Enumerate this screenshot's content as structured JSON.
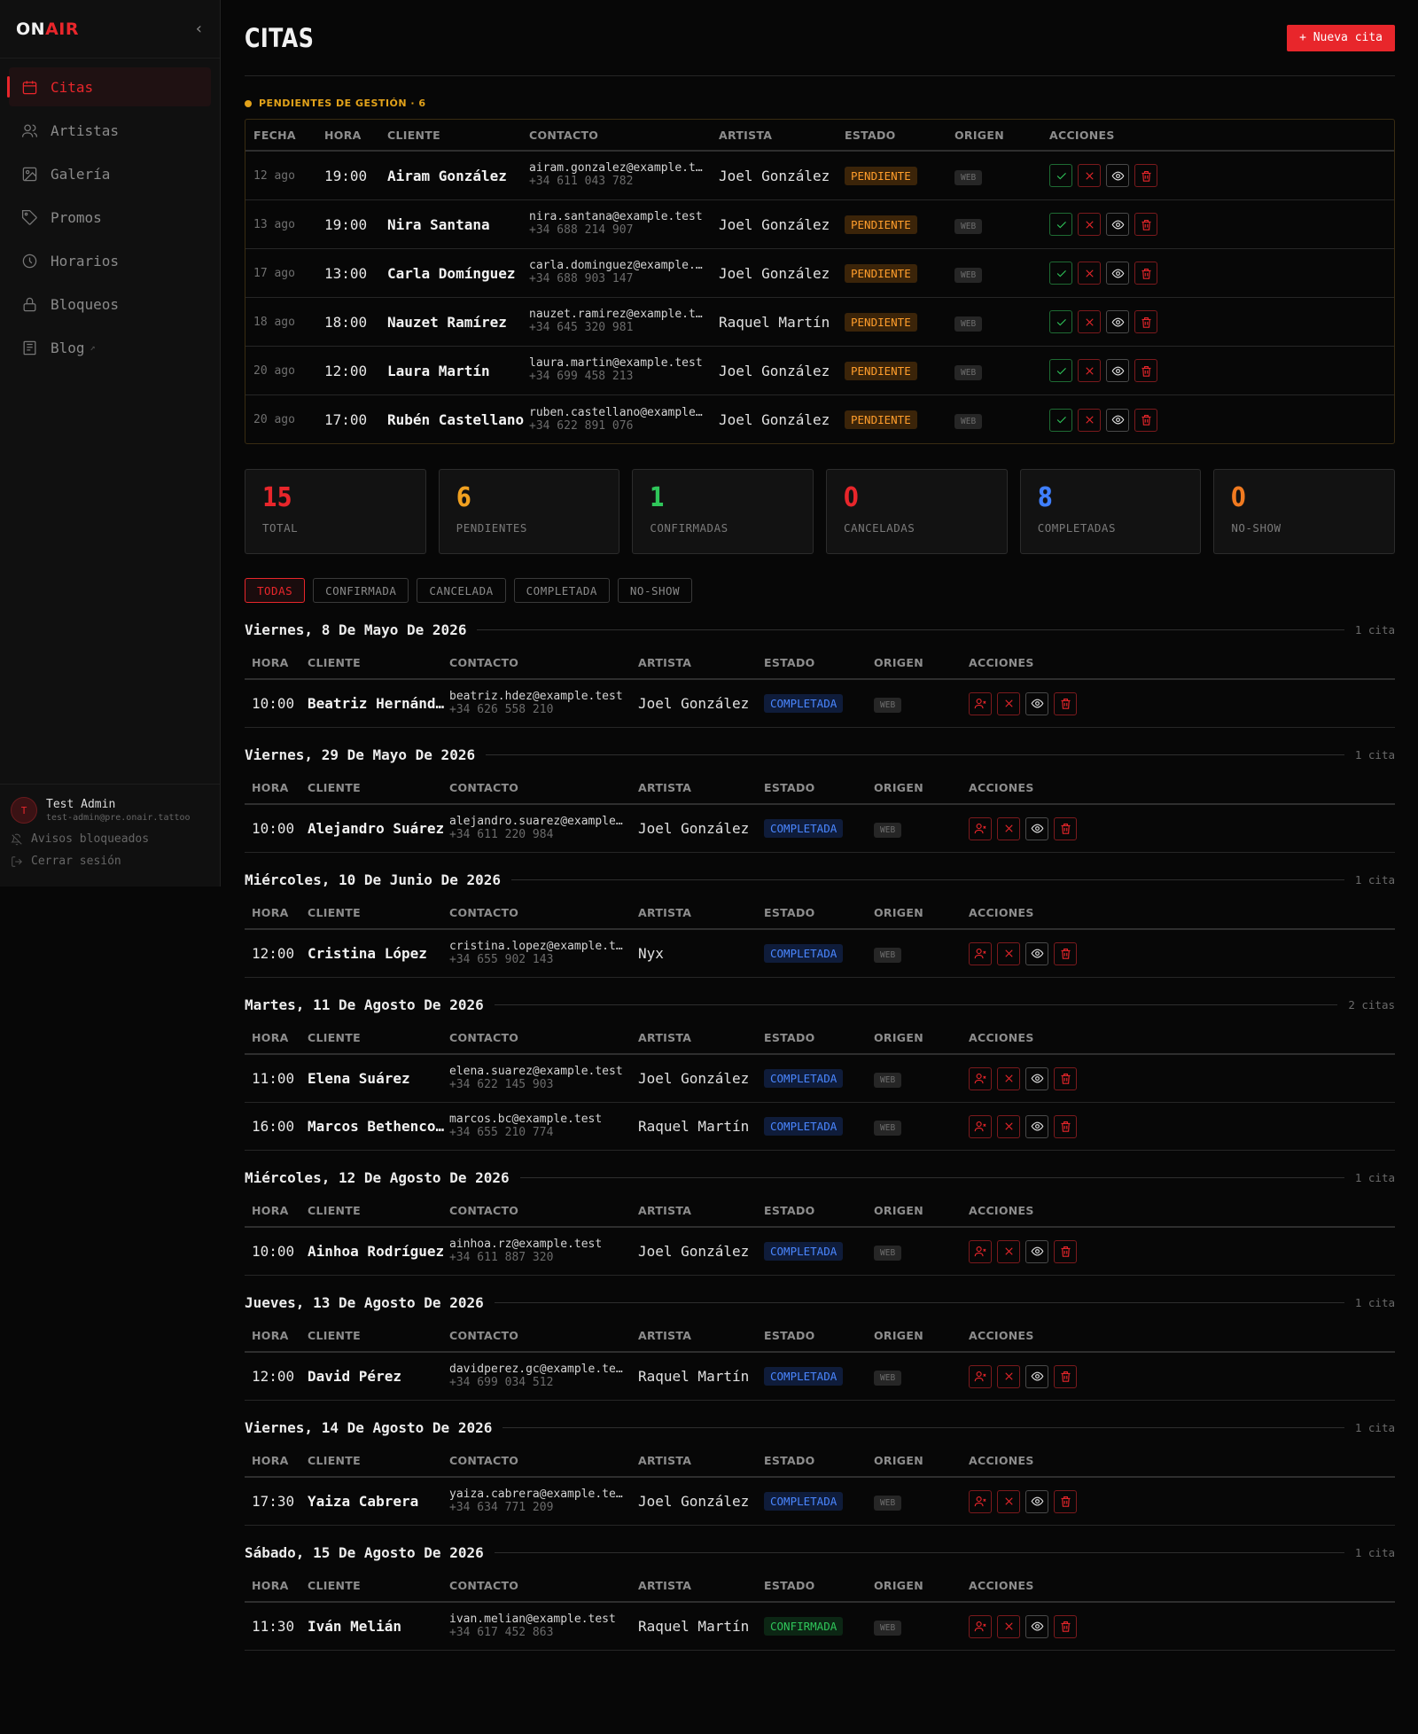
{
  "app": {
    "logo_on": "ON",
    "logo_air": "AIR"
  },
  "sidebar": {
    "items": [
      {
        "label": "Citas",
        "icon": "calendar-icon"
      },
      {
        "label": "Artistas",
        "icon": "users-icon"
      },
      {
        "label": "Galería",
        "icon": "image-icon"
      },
      {
        "label": "Promos",
        "icon": "tag-icon"
      },
      {
        "label": "Horarios",
        "icon": "clock-icon"
      },
      {
        "label": "Bloqueos",
        "icon": "lock-icon"
      },
      {
        "label": "Blog",
        "icon": "blog-icon",
        "ext": "↗"
      }
    ],
    "user": {
      "initial": "T",
      "name": "Test Admin",
      "email": "test-admin@pre.onair.tattoo"
    },
    "notices": "Avisos bloqueados",
    "logout": "Cerrar sesión"
  },
  "header": {
    "title": "CITAS",
    "new_button": "+ Nueva cita"
  },
  "pending": {
    "title": "PENDIENTES DE GESTIÓN · 6",
    "columns": [
      "FECHA",
      "HORA",
      "CLIENTE",
      "CONTACTO",
      "ARTISTA",
      "ESTADO",
      "ORIGEN",
      "ACCIONES"
    ],
    "rows": [
      {
        "date": "12 ago",
        "time": "19:00",
        "client": "Airam González",
        "email": "airam.gonzalez@example.test",
        "phone": "+34 611 043 782",
        "artist": "Joel González",
        "status": "PENDIENTE",
        "origin": "WEB"
      },
      {
        "date": "13 ago",
        "time": "19:00",
        "client": "Nira Santana",
        "email": "nira.santana@example.test",
        "phone": "+34 688 214 907",
        "artist": "Joel González",
        "status": "PENDIENTE",
        "origin": "WEB"
      },
      {
        "date": "17 ago",
        "time": "13:00",
        "client": "Carla Domínguez",
        "email": "carla.dominguez@example.test",
        "phone": "+34 688 903 147",
        "artist": "Joel González",
        "status": "PENDIENTE",
        "origin": "WEB"
      },
      {
        "date": "18 ago",
        "time": "18:00",
        "client": "Nauzet Ramírez",
        "email": "nauzet.ramirez@example.test",
        "phone": "+34 645 320 981",
        "artist": "Raquel Martín",
        "status": "PENDIENTE",
        "origin": "WEB"
      },
      {
        "date": "20 ago",
        "time": "12:00",
        "client": "Laura Martín",
        "email": "laura.martin@example.test",
        "phone": "+34 699 458 213",
        "artist": "Joel González",
        "status": "PENDIENTE",
        "origin": "WEB"
      },
      {
        "date": "20 ago",
        "time": "17:00",
        "client": "Rubén Castellano",
        "email": "ruben.castellano@example.test",
        "phone": "+34 622 891 076",
        "artist": "Joel González",
        "status": "PENDIENTE",
        "origin": "WEB"
      }
    ]
  },
  "stats": [
    {
      "value": "15",
      "label": "TOTAL",
      "color": "#e8262b"
    },
    {
      "value": "6",
      "label": "PENDIENTES",
      "color": "#f0a020"
    },
    {
      "value": "1",
      "label": "CONFIRMADAS",
      "color": "#2fc65a"
    },
    {
      "value": "0",
      "label": "CANCELADAS",
      "color": "#e8262b"
    },
    {
      "value": "8",
      "label": "COMPLETADAS",
      "color": "#3f7fff"
    },
    {
      "value": "0",
      "label": "NO-SHOW",
      "color": "#f07a20"
    }
  ],
  "filters": [
    "TODAS",
    "CONFIRMADA",
    "CANCELADA",
    "COMPLETADA",
    "NO-SHOW"
  ],
  "group_columns": [
    "HORA",
    "CLIENTE",
    "CONTACTO",
    "ARTISTA",
    "ESTADO",
    "ORIGEN",
    "ACCIONES"
  ],
  "groups": [
    {
      "title": "Viernes, 8 De Mayo De 2026",
      "count": "1 cita",
      "rows": [
        {
          "time": "10:00",
          "client": "Beatriz Hernández",
          "email": "beatriz.hdez@example.test",
          "phone": "+34 626 558 210",
          "artist": "Joel González",
          "status": "COMPLETADA",
          "origin": "WEB"
        }
      ]
    },
    {
      "title": "Viernes, 29 De Mayo De 2026",
      "count": "1 cita",
      "rows": [
        {
          "time": "10:00",
          "client": "Alejandro Suárez",
          "email": "alejandro.suarez@example.test",
          "phone": "+34 611 220 984",
          "artist": "Joel González",
          "status": "COMPLETADA",
          "origin": "WEB"
        }
      ]
    },
    {
      "title": "Miércoles, 10 De Junio De 2026",
      "count": "1 cita",
      "rows": [
        {
          "time": "12:00",
          "client": "Cristina López",
          "email": "cristina.lopez@example.test",
          "phone": "+34 655 902 143",
          "artist": "Nyx",
          "status": "COMPLETADA",
          "origin": "WEB"
        }
      ]
    },
    {
      "title": "Martes, 11 De Agosto De 2026",
      "count": "2 citas",
      "rows": [
        {
          "time": "11:00",
          "client": "Elena Suárez",
          "email": "elena.suarez@example.test",
          "phone": "+34 622 145 903",
          "artist": "Joel González",
          "status": "COMPLETADA",
          "origin": "WEB"
        },
        {
          "time": "16:00",
          "client": "Marcos Bethencourt",
          "email": "marcos.bc@example.test",
          "phone": "+34 655 210 774",
          "artist": "Raquel Martín",
          "status": "COMPLETADA",
          "origin": "WEB"
        }
      ]
    },
    {
      "title": "Miércoles, 12 De Agosto De 2026",
      "count": "1 cita",
      "rows": [
        {
          "time": "10:00",
          "client": "Ainhoa Rodríguez",
          "email": "ainhoa.rz@example.test",
          "phone": "+34 611 887 320",
          "artist": "Joel González",
          "status": "COMPLETADA",
          "origin": "WEB"
        }
      ]
    },
    {
      "title": "Jueves, 13 De Agosto De 2026",
      "count": "1 cita",
      "rows": [
        {
          "time": "12:00",
          "client": "David Pérez",
          "email": "davidperez.gc@example.test",
          "phone": "+34 699 034 512",
          "artist": "Raquel Martín",
          "status": "COMPLETADA",
          "origin": "WEB"
        }
      ]
    },
    {
      "title": "Viernes, 14 De Agosto De 2026",
      "count": "1 cita",
      "rows": [
        {
          "time": "17:30",
          "client": "Yaiza Cabrera",
          "email": "yaiza.cabrera@example.test",
          "phone": "+34 634 771 209",
          "artist": "Joel González",
          "status": "COMPLETADA",
          "origin": "WEB"
        }
      ]
    },
    {
      "title": "Sábado, 15 De Agosto De 2026",
      "count": "1 cita",
      "rows": [
        {
          "time": "11:30",
          "client": "Iván Melián",
          "email": "ivan.melian@example.test",
          "phone": "+34 617 452 863",
          "artist": "Raquel Martín",
          "status": "CONFIRMADA",
          "origin": "WEB"
        }
      ]
    }
  ]
}
